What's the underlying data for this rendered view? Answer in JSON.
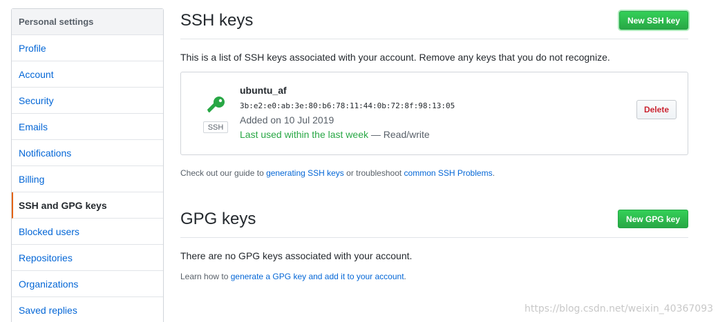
{
  "sidebar": {
    "header": "Personal settings",
    "items": [
      {
        "label": "Profile"
      },
      {
        "label": "Account"
      },
      {
        "label": "Security"
      },
      {
        "label": "Emails"
      },
      {
        "label": "Notifications"
      },
      {
        "label": "Billing"
      },
      {
        "label": "SSH and GPG keys",
        "active": true
      },
      {
        "label": "Blocked users"
      },
      {
        "label": "Repositories"
      },
      {
        "label": "Organizations"
      },
      {
        "label": "Saved replies"
      }
    ]
  },
  "ssh": {
    "title": "SSH keys",
    "new_button": "New SSH key",
    "description": "This is a list of SSH keys associated with your account. Remove any keys that you do not recognize.",
    "key": {
      "icon": "key-icon",
      "type_label": "SSH",
      "name": "ubuntu_af",
      "fingerprint": "3b:e2:e0:ab:3e:80:b6:78:11:44:0b:72:8f:98:13:05",
      "added": "Added on 10 Jul 2019",
      "last_used": "Last used within the last week",
      "access": " — Read/write",
      "delete_button": "Delete"
    },
    "guide": {
      "prefix": "Check out our guide to ",
      "link1": "generating SSH keys",
      "middle": " or troubleshoot ",
      "link2": "common SSH Problems",
      "suffix": "."
    }
  },
  "gpg": {
    "title": "GPG keys",
    "new_button": "New GPG key",
    "empty": "There are no GPG keys associated with your account.",
    "learn": {
      "prefix": "Learn how to ",
      "link": "generate a GPG key and add it to your account",
      "suffix": "."
    }
  },
  "watermark": "https://blog.csdn.net/weixin_40367093",
  "colors": {
    "accent_link": "#0366d6",
    "primary_green": "#28a745",
    "danger_red": "#cb2431",
    "active_border": "#e36209"
  }
}
